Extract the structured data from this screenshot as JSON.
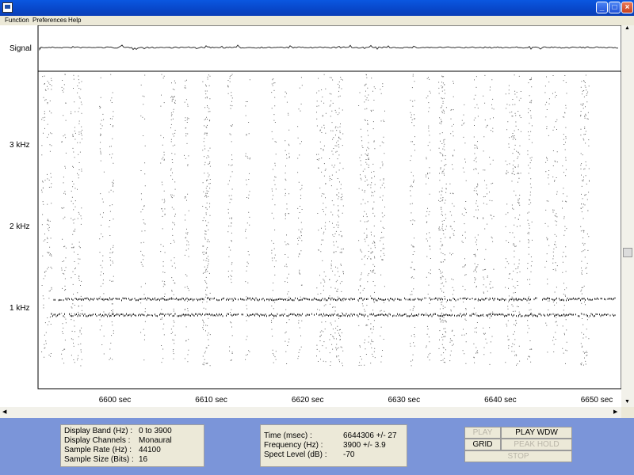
{
  "menu": [
    "Function",
    "Preferences",
    "Help"
  ],
  "window_buttons": {
    "minimize": "_",
    "maximize": "□",
    "close": "×"
  },
  "plot": {
    "signal_label": "Signal",
    "y_labels": [
      {
        "text": "3 kHz",
        "freq": 3000
      },
      {
        "text": "2 kHz",
        "freq": 2000
      },
      {
        "text": "1 kHz",
        "freq": 1000
      }
    ],
    "x_labels": [
      {
        "text": "6600 sec",
        "t": 6600
      },
      {
        "text": "6610 sec",
        "t": 6610
      },
      {
        "text": "6620 sec",
        "t": 6620
      },
      {
        "text": "6630 sec",
        "t": 6630
      },
      {
        "text": "6640 sec",
        "t": 6640
      },
      {
        "text": "6650 sec",
        "t": 6650
      }
    ]
  },
  "display_info": [
    {
      "label": "Display Band (Hz) :",
      "value": "0 to 3900"
    },
    {
      "label": "Display Channels :",
      "value": "Monaural"
    },
    {
      "label": "Sample Rate (Hz) :",
      "value": "44100"
    },
    {
      "label": "Sample Size (Bits) :",
      "value": "16"
    }
  ],
  "cursor_info": [
    {
      "label": "Time (msec) :",
      "value": "6644306 +/- 27"
    },
    {
      "label": "Frequency (Hz) :",
      "value": "3900 +/- 3.9"
    },
    {
      "label": "Spect Level (dB) :",
      "value": "-70"
    }
  ],
  "controls": {
    "play": "PLAY",
    "play_wdw": "PLAY WDW",
    "grid": "GRID",
    "peak_hold": "PEAK HOLD",
    "stop": "STOP"
  }
}
